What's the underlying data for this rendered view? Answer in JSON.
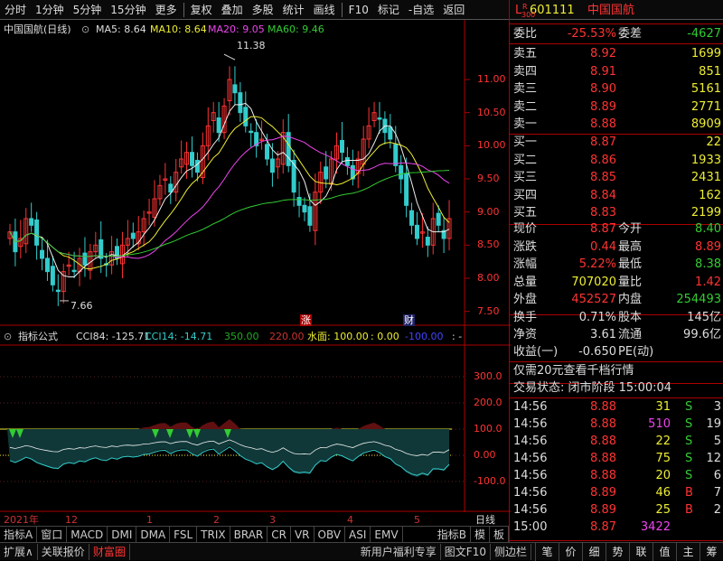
{
  "toolbar": {
    "items": [
      "分时",
      "1分钟",
      "5分钟",
      "15分钟",
      "更多",
      "复权",
      "叠加",
      "多股",
      "统计",
      "画线",
      "F10",
      "标记",
      "-自选",
      "返回"
    ]
  },
  "stock": {
    "code": "601111",
    "name": "中国国航",
    "badge_top": "R",
    "badge_bot": "300",
    "badge_l": "L"
  },
  "title_row": {
    "name": "中国国航(日线)",
    "ma5": "MA5: 8.64",
    "ma10": "MA10: 8.64",
    "ma20": "MA20: 9.05",
    "ma60": "MA60: 9.46"
  },
  "price_axis": [
    "11.00",
    "10.50",
    "10.00",
    "9.50",
    "9.00",
    "8.50",
    "8.00",
    "7.50"
  ],
  "annot": {
    "high": "11.38",
    "low": "7.66",
    "zhang": "涨",
    "cai": "财"
  },
  "indicator": {
    "name": "指标公式",
    "cci84": "CCI84: -125.71",
    "cci14": "CCI14: -14.71",
    "v350": "350.00",
    "v220": "220.00",
    "water": "水面: 100.00",
    "v0": ": 0.00",
    "vn100": "-100.00",
    "dash": ": -"
  },
  "ind_axis": [
    "300.0",
    "200.0",
    "100.0",
    "0.00",
    "-100.0"
  ],
  "date_axis": {
    "year": "2021年",
    "m12": "12",
    "m1": "1",
    "m2": "2",
    "m3": "3",
    "m4": "4",
    "m5": "5",
    "period": "日线"
  },
  "bottom1": [
    "指标A",
    "窗口",
    "MACD",
    "DMI",
    "DMA",
    "FSL",
    "TRIX",
    "BRAR",
    "CR",
    "VR",
    "OBV",
    "ASI",
    "EMV",
    "指标B",
    "模",
    "板"
  ],
  "bottom2": {
    "expand": "扩展∧",
    "quote": "关联报价",
    "fortune": "财富圈",
    "promo": "新用户福利专享",
    "f10": "图文F10",
    "side": "侧边栏"
  },
  "quote": {
    "webi_l": "委比",
    "webi_v": "-25.53%",
    "wecha_l": "委差",
    "wecha_v": "-4627",
    "sells": [
      [
        "卖五",
        "8.92",
        "1699"
      ],
      [
        "卖四",
        "8.91",
        "851"
      ],
      [
        "卖三",
        "8.90",
        "5161"
      ],
      [
        "卖二",
        "8.89",
        "2771"
      ],
      [
        "卖一",
        "8.88",
        "8909"
      ]
    ],
    "buys": [
      [
        "买一",
        "8.87",
        "22"
      ],
      [
        "买二",
        "8.86",
        "1933"
      ],
      [
        "买三",
        "8.85",
        "2431"
      ],
      [
        "买四",
        "8.84",
        "162"
      ],
      [
        "买五",
        "8.83",
        "2199"
      ]
    ],
    "stats": [
      [
        "现价",
        "8.87",
        "今开",
        "8.40"
      ],
      [
        "涨跌",
        "0.44",
        "最高",
        "8.89"
      ],
      [
        "涨幅",
        "5.22%",
        "最低",
        "8.38"
      ],
      [
        "总量",
        "707020",
        "量比",
        "1.42"
      ],
      [
        "外盘",
        "452527",
        "内盘",
        "254493"
      ]
    ],
    "stats2": [
      [
        "换手",
        "0.71%",
        "股本",
        "145亿"
      ],
      [
        "净资",
        "3.61",
        "流通",
        "99.6亿"
      ],
      [
        "收益(一)",
        "-0.650",
        "PE(动)",
        ""
      ]
    ],
    "promo": "仅需20元查看千档行情",
    "status": "交易状态: 闭市阶段 15:00:04",
    "ticks": [
      [
        "14:56",
        "8.88",
        "31",
        "S",
        "3"
      ],
      [
        "14:56",
        "8.88",
        "510",
        "S",
        "19"
      ],
      [
        "14:56",
        "8.88",
        "22",
        "S",
        "5"
      ],
      [
        "14:56",
        "8.88",
        "75",
        "S",
        "12"
      ],
      [
        "14:56",
        "8.88",
        "20",
        "S",
        "6"
      ],
      [
        "14:56",
        "8.89",
        "46",
        "B",
        "7"
      ],
      [
        "14:56",
        "8.89",
        "25",
        "B",
        "2"
      ],
      [
        "15:00",
        "8.87",
        "3422",
        "",
        ""
      ]
    ],
    "tabs": [
      "笔",
      "价",
      "细",
      "势",
      "联",
      "值",
      "主",
      "筹"
    ]
  },
  "chart_data": {
    "type": "candlestick",
    "ylim": [
      7.4,
      11.6
    ],
    "closes": [
      8.7,
      8.4,
      8.6,
      8.9,
      8.8,
      8.5,
      8.3,
      8.1,
      7.9,
      7.8,
      8.1,
      8.2,
      8.1,
      8.3,
      8.2,
      8.4,
      8.5,
      8.3,
      8.2,
      8.4,
      8.3,
      8.5,
      8.6,
      8.6,
      8.7,
      8.9,
      9.0,
      9.2,
      9.4,
      9.5,
      9.3,
      9.6,
      9.8,
      9.9,
      9.7,
      9.6,
      10.0,
      10.3,
      10.5,
      10.2,
      10.6,
      11.0,
      10.8,
      10.5,
      10.3,
      10.2,
      10.0,
      10.1,
      9.8,
      9.6,
      9.8,
      10.2,
      9.7,
      9.3,
      9.1,
      9.0,
      8.8,
      9.3,
      9.6,
      9.5,
      9.8,
      10.0,
      9.9,
      9.7,
      9.5,
      9.8,
      10.1,
      10.3,
      10.5,
      10.4,
      10.2,
      10.1,
      9.7,
      9.5,
      9.1,
      8.8,
      8.6,
      8.7,
      8.5,
      8.9,
      8.8,
      8.6,
      8.9
    ]
  }
}
